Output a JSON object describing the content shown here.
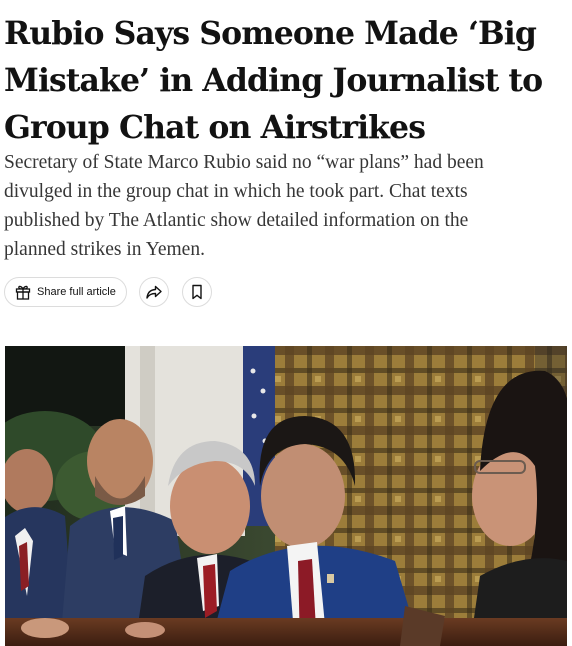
{
  "article": {
    "headline_lines": [
      "Rubio Says Someone Made ‘Big",
      "Mistake’ in Adding Journalist to",
      "Group Chat on Airstrikes"
    ],
    "summary_lines": [
      "Secretary of State Marco Rubio said no “war plans” had been",
      "divulged in the group chat in which he took part. Chat texts",
      "published by The Atlantic show detailed information on the",
      "planned strikes in Yemen."
    ]
  },
  "actions": {
    "share_label": "Share full article",
    "share_icon": "gift-icon",
    "forward_icon": "share-arrow-icon",
    "bookmark_icon": "bookmark-icon"
  },
  "colors": {
    "headline": "#121212",
    "summary": "#363636",
    "button_border": "#dcdcdc"
  }
}
